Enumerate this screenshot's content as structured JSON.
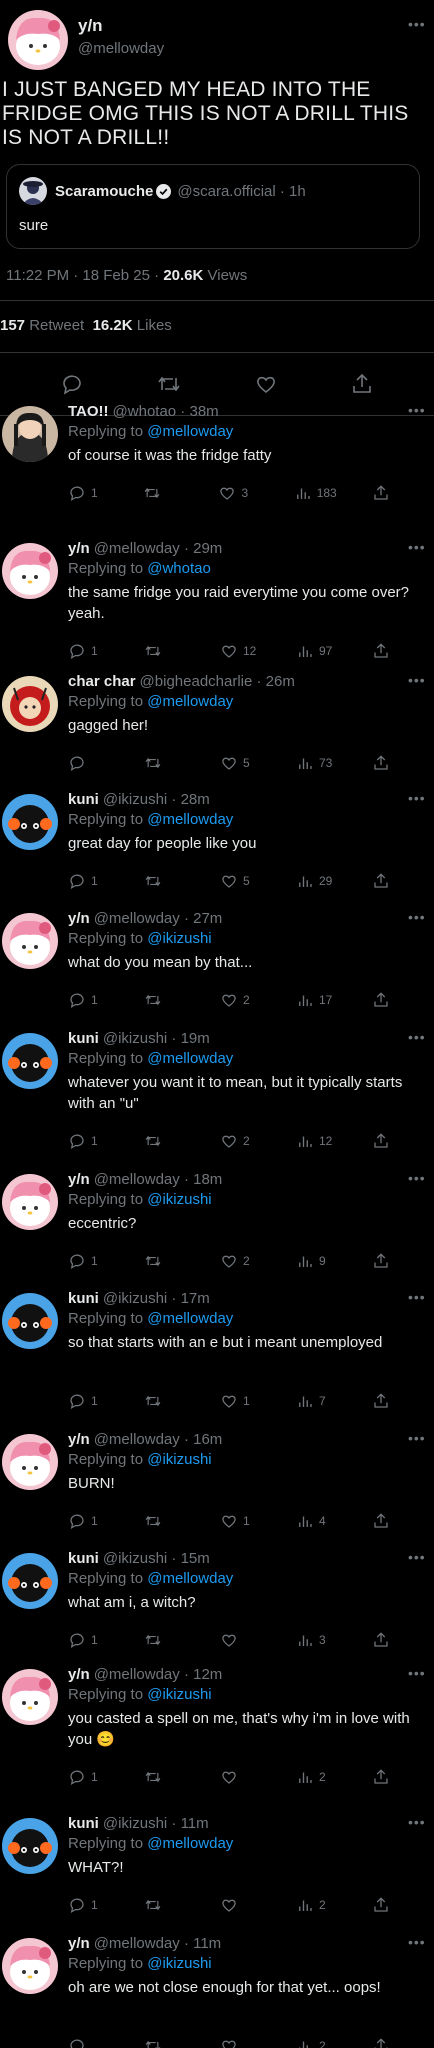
{
  "main_tweet": {
    "author_name": "y/n",
    "author_handle": "@mellowday",
    "text": "I JUST BANGED MY HEAD INTO THE FRIDGE OMG THIS IS NOT A DRILL THIS IS NOT A DRILL!!",
    "quote": {
      "name": "Scaramouche",
      "handle_time": "@scara.official · 1h",
      "text": "sure"
    },
    "timestamp": "11:22 PM · 18 Feb 25 · ",
    "views_count": "20.6K",
    "views_label": " Views",
    "retweets_count": "157",
    "retweets_label": " Retweet",
    "likes_count": "16.2K",
    "likes_label": " Likes"
  },
  "replying_prefix": "Replying to ",
  "replies": [
    {
      "name": "TAO!!",
      "handle_time": "@whotao · 38m",
      "reply_to": "@mellowday",
      "text": "of course it was the fridge fatty",
      "replies": "1",
      "likes": "3",
      "views": "183",
      "avatar": "tao-avatar"
    },
    {
      "name": "y/n",
      "handle_time": "@mellowday · 29m",
      "reply_to": "@whotao",
      "text": "the same fridge you raid everytime you come over? yeah.",
      "replies": "1",
      "likes": "12",
      "views": "97",
      "avatar": "melody-avatar"
    },
    {
      "name": "char char",
      "handle_time": "@bigheadcharlie · 26m",
      "reply_to": "@mellowday",
      "text": "gagged her!",
      "replies": "",
      "likes": "5",
      "views": "73",
      "avatar": "charlie-avatar"
    },
    {
      "name": "kuni",
      "handle_time": "@ikizushi · 28m",
      "reply_to": "@mellowday",
      "text": "great day for people like you",
      "replies": "1",
      "likes": "5",
      "views": "29",
      "avatar": "kuni-avatar"
    },
    {
      "name": "y/n",
      "handle_time": "@mellowday · 27m",
      "reply_to": "@ikizushi",
      "text": "what do you mean by that...",
      "replies": "1",
      "likes": "2",
      "views": "17",
      "avatar": "melody-avatar"
    },
    {
      "name": "kuni",
      "handle_time": "@ikizushi · 19m",
      "reply_to": "@mellowday",
      "text": "whatever you want it to mean, but it typically starts with an \"u\"",
      "replies": "1",
      "likes": "2",
      "views": "12",
      "avatar": "kuni-avatar"
    },
    {
      "name": "y/n",
      "handle_time": "@mellowday · 18m",
      "reply_to": "@ikizushi",
      "text": "eccentric?",
      "replies": "1",
      "likes": "2",
      "views": "9",
      "avatar": "melody-avatar"
    },
    {
      "name": "kuni",
      "handle_time": "@ikizushi · 17m",
      "reply_to": "@mellowday",
      "text": "so that starts with an e but i meant unemployed",
      "replies": "1",
      "likes": "1",
      "views": "7",
      "avatar": "kuni-avatar"
    },
    {
      "name": "y/n",
      "handle_time": "@mellowday · 16m",
      "reply_to": "@ikizushi",
      "text": "BURN!",
      "replies": "1",
      "likes": "1",
      "views": "4",
      "avatar": "melody-avatar"
    },
    {
      "name": "kuni",
      "handle_time": "@ikizushi · 15m",
      "reply_to": "@mellowday",
      "text": "what am i, a witch?",
      "replies": "1",
      "likes": "",
      "views": "3",
      "avatar": "kuni-avatar"
    },
    {
      "name": "y/n",
      "handle_time": "@mellowday · 12m",
      "reply_to": "@ikizushi",
      "text": "you casted a spell on me, that's why i'm in love with you 😊",
      "replies": "1",
      "likes": "",
      "views": "2",
      "avatar": "melody-avatar"
    },
    {
      "name": "kuni",
      "handle_time": "@ikizushi · 11m",
      "reply_to": "@mellowday",
      "text": "WHAT?!",
      "replies": "1",
      "likes": "",
      "views": "2",
      "avatar": "kuni-avatar"
    },
    {
      "name": "y/n",
      "handle_time": "@mellowday · 11m",
      "reply_to": "@ikizushi",
      "text": "oh are we not close enough for that yet... oops!",
      "replies": "",
      "likes": "",
      "views": "2",
      "avatar": "melody-avatar"
    }
  ],
  "colors": {
    "background": "#000000",
    "text": "#e7e9ea",
    "muted": "#71767b",
    "link": "#1d9bf0",
    "border": "#2f3336"
  }
}
